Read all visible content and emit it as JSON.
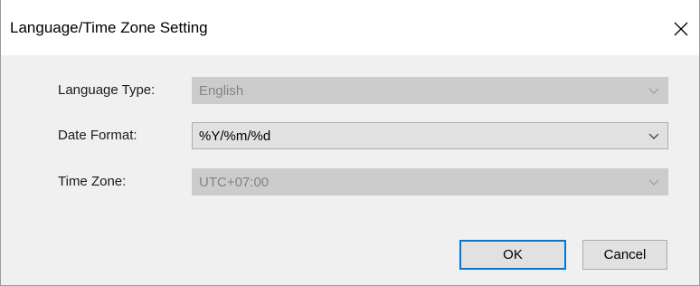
{
  "window": {
    "title": "Language/Time Zone Setting",
    "close_icon": "close-icon"
  },
  "form": {
    "language_type": {
      "label": "Language Type:",
      "value": "English",
      "enabled": false
    },
    "date_format": {
      "label": "Date Format:",
      "value": "%Y/%m/%d",
      "enabled": true
    },
    "time_zone": {
      "label": "Time Zone:",
      "value": "UTC+07:00",
      "enabled": false
    }
  },
  "buttons": {
    "ok_label": "OK",
    "cancel_label": "Cancel"
  },
  "colors": {
    "accent": "#0078d7",
    "dialog_background": "#f0f0f0",
    "disabled_text": "#838383"
  }
}
